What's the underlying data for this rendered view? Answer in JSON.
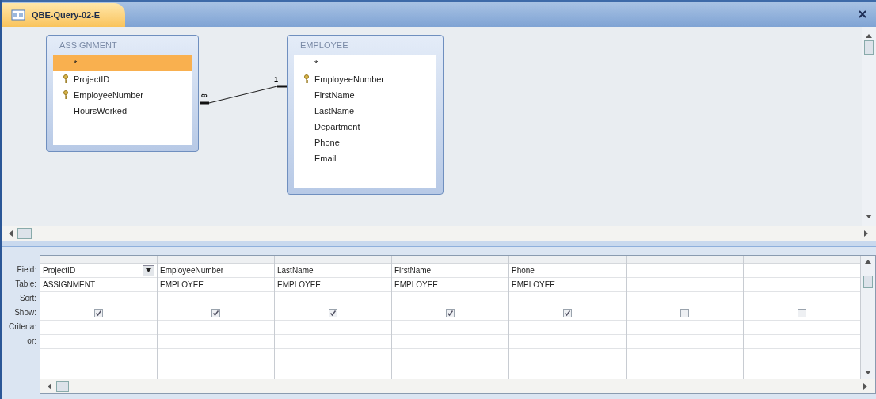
{
  "tab": {
    "title": "QBE-Query-02-E",
    "selected": true
  },
  "tables": [
    {
      "name": "ASSIGNMENT",
      "fields": [
        {
          "label": "*",
          "key": false,
          "selected": true
        },
        {
          "label": "ProjectID",
          "key": true,
          "selected": false
        },
        {
          "label": "EmployeeNumber",
          "key": true,
          "selected": false
        },
        {
          "label": "HoursWorked",
          "key": false,
          "selected": false
        }
      ]
    },
    {
      "name": "EMPLOYEE",
      "fields": [
        {
          "label": "*",
          "key": false,
          "selected": false
        },
        {
          "label": "EmployeeNumber",
          "key": true,
          "selected": false
        },
        {
          "label": "FirstName",
          "key": false,
          "selected": false
        },
        {
          "label": "LastName",
          "key": false,
          "selected": false
        },
        {
          "label": "Department",
          "key": false,
          "selected": false
        },
        {
          "label": "Phone",
          "key": false,
          "selected": false
        },
        {
          "label": "Email",
          "key": false,
          "selected": false
        }
      ]
    }
  ],
  "relationship": {
    "many_label": "∞",
    "one_label": "1"
  },
  "grid": {
    "row_labels": [
      "Field:",
      "Table:",
      "Sort:",
      "Show:",
      "Criteria:",
      "or:"
    ],
    "columns": [
      {
        "field": "ProjectID",
        "table": "ASSIGNMENT",
        "show": true,
        "dropdown": true
      },
      {
        "field": "EmployeeNumber",
        "table": "EMPLOYEE",
        "show": true,
        "dropdown": false
      },
      {
        "field": "LastName",
        "table": "EMPLOYEE",
        "show": true,
        "dropdown": false
      },
      {
        "field": "FirstName",
        "table": "EMPLOYEE",
        "show": true,
        "dropdown": false
      },
      {
        "field": "Phone",
        "table": "EMPLOYEE",
        "show": true,
        "dropdown": false
      },
      {
        "show": false,
        "dropdown": false
      },
      {
        "show": false,
        "dropdown": false
      }
    ]
  }
}
